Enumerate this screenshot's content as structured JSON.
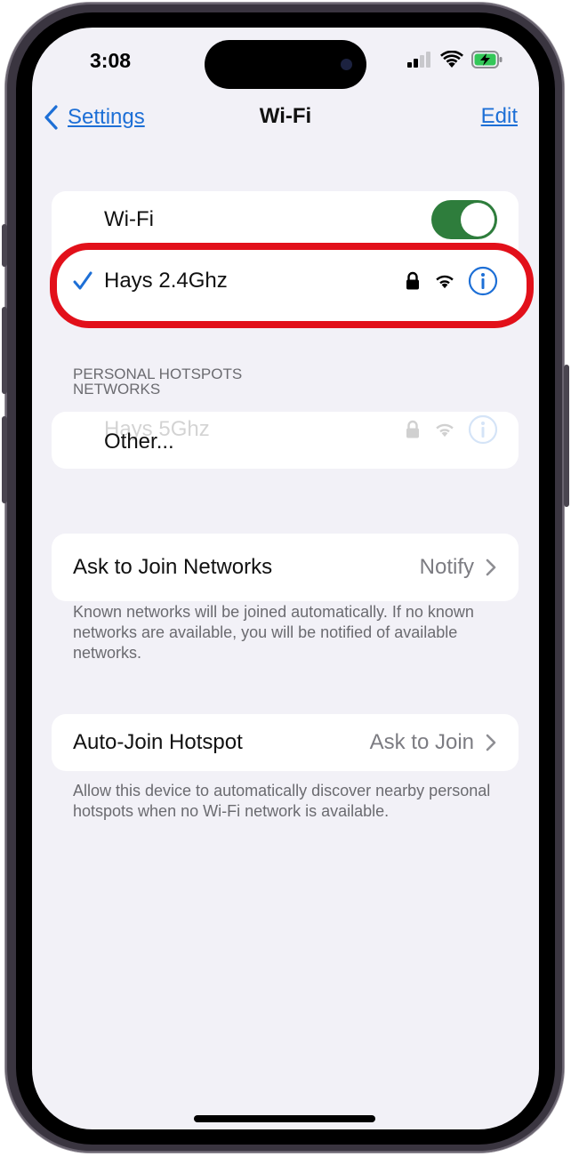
{
  "status_bar": {
    "time": "3:08"
  },
  "nav": {
    "back_label": "Settings",
    "title": "Wi-Fi",
    "edit_label": "Edit"
  },
  "wifi": {
    "toggle_label": "Wi-Fi",
    "toggle_on": true,
    "connected_network": "Hays 2.4Ghz"
  },
  "personal_hotspots_header": "PERSONAL HOTSPOTS",
  "networks_header": "NETWORKS",
  "networks": {
    "faded_network": "Hays 5Ghz",
    "other_label": "Other..."
  },
  "ask_to_join": {
    "label": "Ask to Join Networks",
    "value": "Notify",
    "footnote": "Known networks will be joined automatically. If no known networks are available, you will be notified of available networks."
  },
  "auto_join_hotspot": {
    "label": "Auto-Join Hotspot",
    "value": "Ask to Join",
    "footnote": "Allow this device to automatically discover nearby personal hotspots when no Wi-Fi network is available."
  },
  "colors": {
    "accent": "#1d6fd6",
    "toggle_on": "#2e7d3c",
    "highlight_ring": "#e2101a",
    "screen_bg": "#f2f1f7"
  },
  "icons": [
    "checkmark-icon",
    "lock-icon",
    "wifi-icon",
    "info-icon",
    "chevron-right-icon",
    "chevron-left-icon",
    "signal-icon",
    "battery-charging-icon"
  ]
}
